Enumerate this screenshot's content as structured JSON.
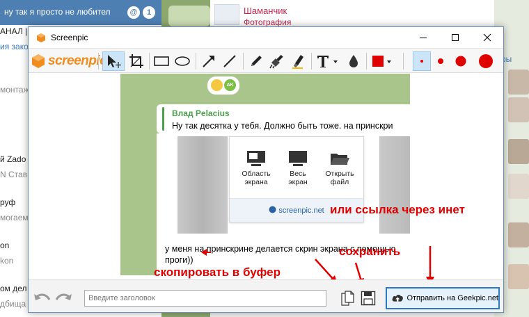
{
  "background": {
    "chat_list": {
      "top_text": "ну так я просто не любител",
      "at_badge": "@",
      "unread_count": "1",
      "rows": [
        {
          "text": "АНАЛ |",
          "style": "dark"
        },
        {
          "text": "ия зако",
          "style": "blue"
        },
        {
          "text": "монтаж",
          "style": "gray"
        },
        {
          "text": "й Zado",
          "style": "dark"
        },
        {
          "text": "N Став",
          "style": "gray"
        },
        {
          "text": "руф",
          "style": "dark"
        },
        {
          "text": "могаем",
          "style": "gray"
        },
        {
          "text": "on",
          "style": "dark"
        },
        {
          "text": "kon",
          "style": "gray"
        },
        {
          "text": "ом дел",
          "style": "dark"
        },
        {
          "text": "дбища",
          "style": "gray"
        }
      ]
    },
    "card": {
      "name": "Шаманчик",
      "subtitle": "Фотография"
    },
    "right_label": "ры"
  },
  "window": {
    "title": "Screenpic",
    "logo_text": "screenpic",
    "colors": {
      "accent": "#f08c1e",
      "annotation": "#e00000",
      "selected": "#cce4f7"
    }
  },
  "toolbar": {
    "tools": [
      {
        "name": "select",
        "icon": "arrow-cursor-icon"
      },
      {
        "name": "crop",
        "icon": "crop-icon"
      },
      {
        "name": "rectangle",
        "icon": "rectangle-icon"
      },
      {
        "name": "ellipse",
        "icon": "ellipse-icon"
      },
      {
        "name": "arrow",
        "icon": "arrow-icon"
      },
      {
        "name": "line",
        "icon": "line-icon"
      },
      {
        "name": "pencil",
        "icon": "pencil-icon"
      },
      {
        "name": "brush",
        "icon": "brush-icon"
      },
      {
        "name": "marker",
        "icon": "marker-icon"
      },
      {
        "name": "text",
        "icon": "text-icon"
      },
      {
        "name": "blur",
        "icon": "drop-icon"
      },
      {
        "name": "color",
        "icon": "color-swatch-icon",
        "value": "#e00000"
      }
    ],
    "sizes": [
      "xs",
      "s",
      "m",
      "l"
    ]
  },
  "screenshot": {
    "msg1": {
      "author": "Влад Pelacius",
      "text": "Ну так десятка у тебя. Должно быть тоже. на принскри"
    },
    "panel": {
      "options": [
        {
          "label1": "Область",
          "label2": "экрана"
        },
        {
          "label1": "Весь",
          "label2": "экран"
        },
        {
          "label1": "Открыть",
          "label2": "файл"
        }
      ],
      "site": "screenpic.net"
    },
    "msg2": {
      "line1": "у меня на принскрине делается скрин экрана с помощью",
      "line2": "проги))"
    }
  },
  "annotations": {
    "inet": "или ссылка через инет",
    "save": "сохранить",
    "copy": "скопировать в буфер"
  },
  "bottom": {
    "title_placeholder": "Введите заголовок",
    "send_label": "Отправить на Geekpic.net"
  }
}
